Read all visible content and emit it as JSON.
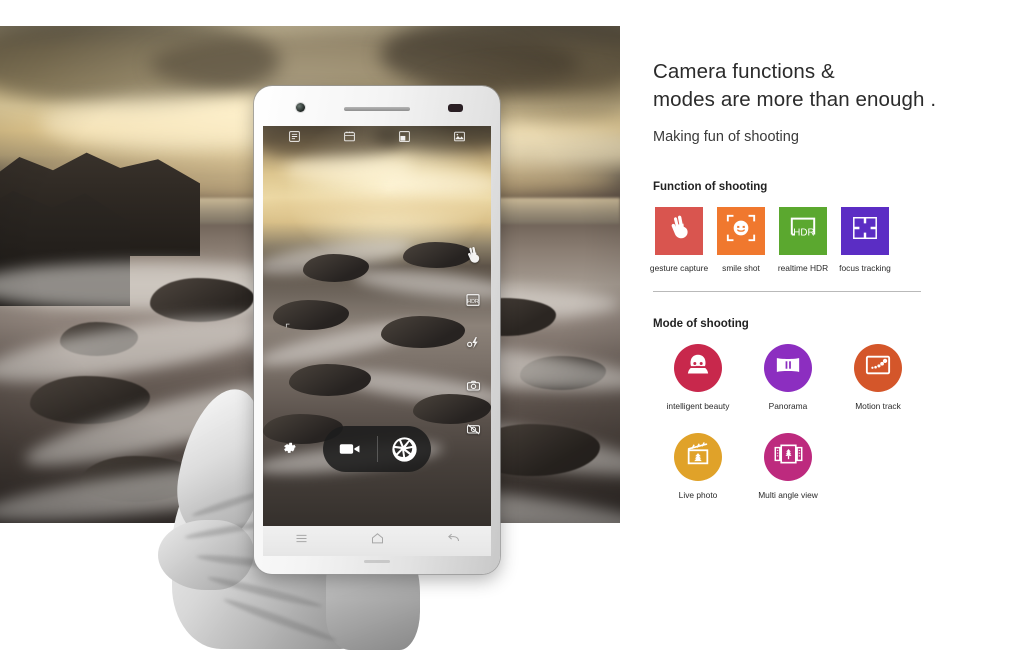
{
  "headline": {
    "line1": "Camera functions &",
    "line2": "modes are more than enough ."
  },
  "subheadline": "Making fun of shooting",
  "function_section": {
    "title": "Function of shooting",
    "items": [
      {
        "label": "gesture capture",
        "icon": "hand-peace-icon",
        "color": "#d9554f"
      },
      {
        "label": "smile shot",
        "icon": "smiling-face-icon",
        "color": "#f0782e"
      },
      {
        "label": "realtime HDR",
        "icon": "hdr-icon",
        "color": "#5ba82f",
        "badge": "HDR"
      },
      {
        "label": "focus tracking",
        "icon": "focus-brackets-icon",
        "color": "#5b2dc4"
      }
    ]
  },
  "mode_section": {
    "title": "Mode of shooting",
    "items": [
      {
        "label": "intelligent beauty",
        "icon": "beauty-face-icon",
        "color": "#c8284c"
      },
      {
        "label": "Panorama",
        "icon": "panorama-icon",
        "color": "#8c2ec0"
      },
      {
        "label": "Motion track",
        "icon": "motion-track-icon",
        "color": "#d4562a"
      },
      {
        "label": "Live photo",
        "icon": "live-photo-icon",
        "color": "#e0a229"
      },
      {
        "label": "Multi angle view",
        "icon": "multi-angle-icon",
        "color": "#bd2a7e"
      }
    ]
  },
  "phone": {
    "camera_ui": {
      "top_icons": [
        "timer-icon",
        "filter-icon",
        "aspect-ratio-icon",
        "gallery-icon"
      ],
      "right_icons": [
        "gesture-capture-icon",
        "hdr-icon",
        "flash-off-icon",
        "timer-camera-icon",
        "no-camera-icon"
      ],
      "settings_icon": "gear-icon",
      "video_button_icon": "video-camera-icon",
      "shutter_button_icon": "aperture-shutter-icon",
      "focus_marker": "⌜"
    },
    "nav_bar": {
      "menu_icon": "menu-icon",
      "home_icon": "home-icon",
      "back_icon": "back-arrow-icon"
    },
    "hardware": {
      "front_camera": "front-camera-icon",
      "earpiece": "earpiece-speaker",
      "proximity_sensor": "proximity-sensor"
    }
  },
  "colors": {
    "background": "#ffffff",
    "text": "#2b2b2b",
    "divider": "#b9b9b9"
  }
}
